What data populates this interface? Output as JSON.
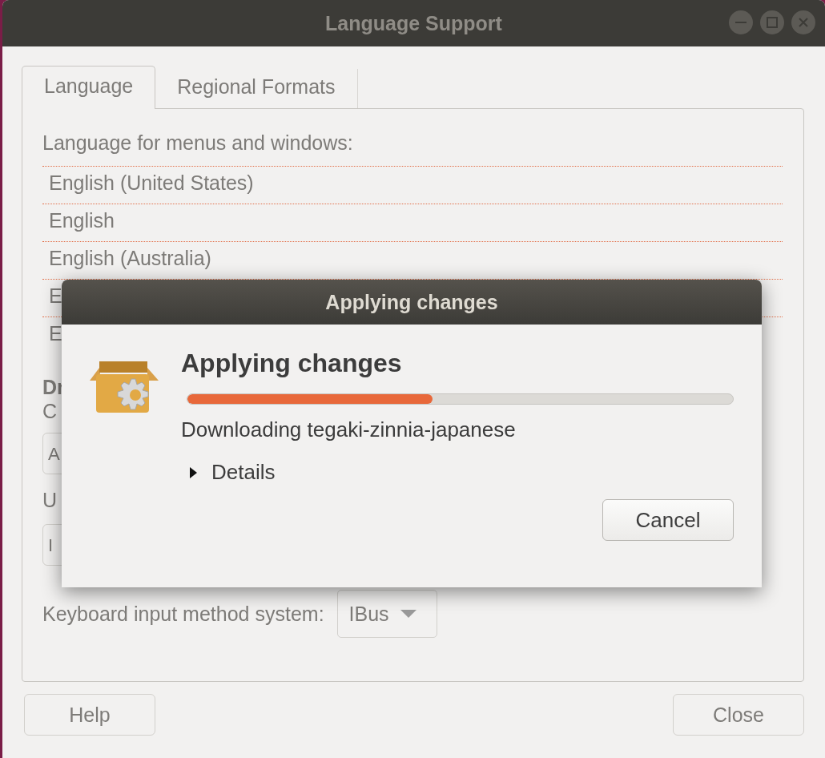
{
  "window": {
    "title": "Language Support"
  },
  "tabs": [
    {
      "label": "Language",
      "selected": true
    },
    {
      "label": "Regional Formats",
      "selected": false
    }
  ],
  "language_panel": {
    "heading": "Language for menus and windows:",
    "languages": [
      {
        "label": "English (United States)"
      },
      {
        "label": "English"
      },
      {
        "label": "English (Australia)"
      },
      {
        "label": "E"
      },
      {
        "label": "E"
      }
    ],
    "partial_heading": "Dr",
    "partial_hint": "C",
    "partial_button": "A",
    "partial_label": "U",
    "partial_button_2": "I",
    "keyboard_label": "Keyboard input method system:",
    "keyboard_value": "IBus"
  },
  "buttons": [
    {
      "label": "Help"
    },
    {
      "label": "Close"
    }
  ],
  "dialog": {
    "title": "Applying changes",
    "heading": "Applying changes",
    "progress": {
      "level": 0.45
    },
    "status": "Downloading tegaki-zinnia-japanese",
    "details": {
      "label": "Details",
      "expanded": false
    },
    "cancel": "Cancel"
  }
}
